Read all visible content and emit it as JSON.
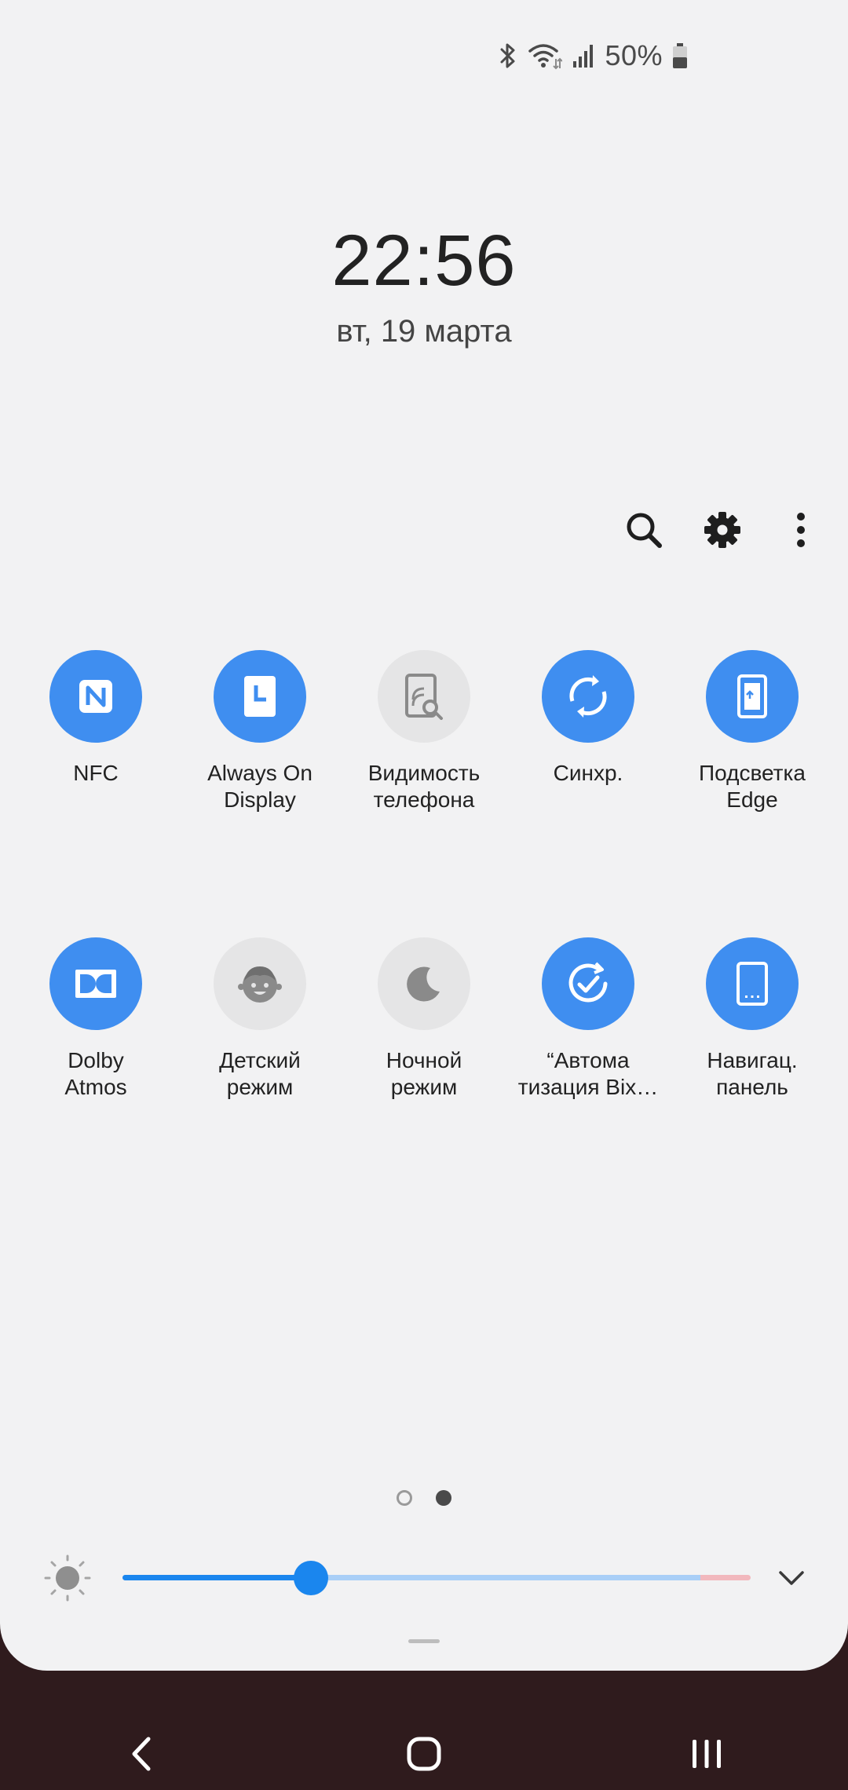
{
  "status_bar": {
    "battery_text": "50%",
    "icons": [
      "bluetooth-icon",
      "wifi-icon",
      "signal-icon",
      "battery-icon"
    ]
  },
  "lockscreen": {
    "time": "22:56",
    "date": "вт, 19 марта"
  },
  "actions": [
    "search-icon",
    "gear-icon",
    "more-vertical-icon"
  ],
  "tiles_row1": [
    {
      "label": "NFC",
      "state": "on",
      "icon": "nfc-icon"
    },
    {
      "label": "Always On\nDisplay",
      "state": "on",
      "icon": "always-on-display-icon"
    },
    {
      "label": "Видимость\nтелефона",
      "state": "off",
      "icon": "phone-visibility-icon"
    },
    {
      "label": "Синхр.",
      "state": "on",
      "icon": "sync-icon"
    },
    {
      "label": "Подсветка\nEdge",
      "state": "on",
      "icon": "edge-lighting-icon"
    }
  ],
  "tiles_row2": [
    {
      "label": "Dolby\nAtmos",
      "state": "on",
      "icon": "dolby-icon"
    },
    {
      "label": "Детский\nрежим",
      "state": "off",
      "icon": "kids-mode-icon"
    },
    {
      "label": "Ночной\nрежим",
      "state": "off",
      "icon": "moon-icon"
    },
    {
      "label": "“Автома\nтизация Bix…",
      "state": "on",
      "icon": "bixby-routines-icon"
    },
    {
      "label": "Навигац.\nпанель",
      "state": "on",
      "icon": "navigation-bar-icon"
    }
  ],
  "pager": {
    "current": 2,
    "total": 2
  },
  "brightness": {
    "level": 0.3
  },
  "colors": {
    "tile_on": "#3f8ef0",
    "tile_off": "#e5e5e6",
    "slider": "#1a86ee",
    "navbar_bg": "#2f1b1d"
  }
}
